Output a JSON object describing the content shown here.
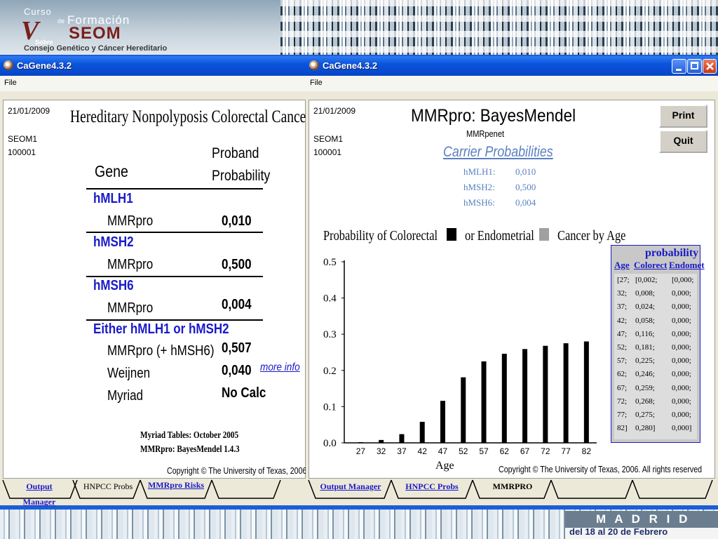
{
  "banner": {
    "logo_curso": "Curso",
    "logo_de": "de",
    "logo_formacion": "Formación",
    "logo_roman": "V",
    "logo_seom": "SEOM",
    "logo_sobre": "Sobre",
    "logo_subtitle": "Consejo Genético y Cáncer Hereditario",
    "footer_city": "M A D R I D",
    "footer_dates": "del 18 al 20 de Febrero"
  },
  "left_window": {
    "title": "CaGene4.3.2",
    "menu_file": "File",
    "date": "21/01/2009",
    "user": "SEOM1",
    "id": "100001",
    "heading": "Hereditary Nonpolyposis Colorectal Cancer",
    "col_gene": "Gene",
    "col_prob_line1": "Proband",
    "col_prob_line2": "Probability",
    "groups": [
      {
        "gene": "hMLH1",
        "rows": [
          {
            "model": "MMRpro",
            "value": "0,010"
          }
        ]
      },
      {
        "gene": "hMSH2",
        "rows": [
          {
            "model": "MMRpro",
            "value": "0,500"
          }
        ]
      },
      {
        "gene": "hMSH6",
        "rows": [
          {
            "model": "MMRpro",
            "value": "0,004"
          }
        ]
      },
      {
        "gene": "Either hMLH1 or hMSH2",
        "rows": [
          {
            "model": "MMRpro (+ hMSH6)",
            "value": "0,507"
          },
          {
            "model": "Weijnen",
            "value": "0,040"
          },
          {
            "model": "Myriad",
            "value": "No Calc"
          }
        ]
      }
    ],
    "more_info": "more info",
    "note1": "Myriad Tables: October 2005",
    "note2": "MMRpro: BayesMendel 1.4.3",
    "copyright": "Copyright © The University of Texas, 2006. All",
    "tabs": [
      "Output Manager",
      "HNPCC Probs",
      "MMRpro Risks"
    ]
  },
  "right_window": {
    "title": "CaGene4.3.2",
    "menu_file": "File",
    "date": "21/01/2009",
    "user": "SEOM1",
    "id": "100001",
    "heading": "MMRpro: BayesMendel",
    "subheading": "MMRpenet",
    "carrier_title": "Carrier Probabilities",
    "carriers": [
      {
        "gene": "hMLH1:",
        "value": "0,010"
      },
      {
        "gene": "hMSH2:",
        "value": "0,500"
      },
      {
        "gene": "hMSH6:",
        "value": "0,004"
      }
    ],
    "print_label": "Print",
    "quit_label": "Quit",
    "chart_heading_a": "Probability of Colorectal",
    "chart_heading_b": "or Endometrial",
    "chart_heading_c": "Cancer by Age",
    "table_title": "probability",
    "table_cols": [
      "Age",
      "Colorect",
      "Endomet"
    ],
    "table_rows": [
      [
        "[27;",
        "[0,002;",
        "[0,000;"
      ],
      [
        "32;",
        "0,008;",
        "0,000;"
      ],
      [
        "37;",
        "0,024;",
        "0,000;"
      ],
      [
        "42;",
        "0,058;",
        "0,000;"
      ],
      [
        "47;",
        "0,116;",
        "0,000;"
      ],
      [
        "52;",
        "0,181;",
        "0,000;"
      ],
      [
        "57;",
        "0,225;",
        "0,000;"
      ],
      [
        "62;",
        "0,246;",
        "0,000;"
      ],
      [
        "67;",
        "0,259;",
        "0,000;"
      ],
      [
        "72;",
        "0,268;",
        "0,000;"
      ],
      [
        "77;",
        "0,275;",
        "0,000;"
      ],
      [
        "82]",
        "0,280]",
        "0,000]"
      ]
    ],
    "copyright": "Copyright © The University of Texas, 2006.  All rights reserved",
    "tabs": [
      "Output Manager",
      "HNPCC Probs",
      "MMRPRO"
    ],
    "colors": {
      "colorectal": "#000000",
      "endometrial": "#a0a0a0",
      "accent_blue": "#1a1ac8",
      "carrier_title": "#5a7fbf"
    }
  },
  "chart_data": {
    "type": "bar",
    "title": "Probability of Colorectal or Endometrial Cancer by Age",
    "xlabel": "Age",
    "ylabel": "",
    "categories": [
      "27",
      "32",
      "37",
      "42",
      "47",
      "52",
      "57",
      "62",
      "67",
      "72",
      "77",
      "82"
    ],
    "series": [
      {
        "name": "Colorectal",
        "values": [
          0.002,
          0.008,
          0.024,
          0.058,
          0.116,
          0.181,
          0.225,
          0.246,
          0.259,
          0.268,
          0.275,
          0.28
        ]
      },
      {
        "name": "Endometrial",
        "values": [
          0,
          0,
          0,
          0,
          0,
          0,
          0,
          0,
          0,
          0,
          0,
          0
        ]
      }
    ],
    "ylim": [
      0,
      0.5
    ],
    "yticks": [
      "0.0",
      "0.1",
      "0.2",
      "0.3",
      "0.4",
      "0.5"
    ],
    "grid": false,
    "legend": "top"
  }
}
